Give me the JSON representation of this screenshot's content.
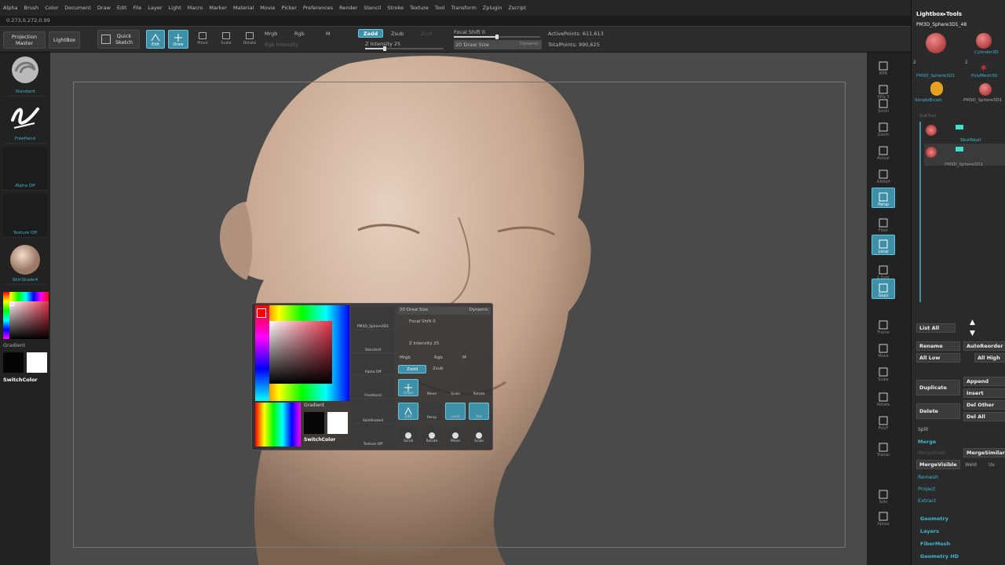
{
  "menu": [
    "Alpha",
    "Brush",
    "Color",
    "Document",
    "Draw",
    "Edit",
    "File",
    "Layer",
    "Light",
    "Macro",
    "Marker",
    "Material",
    "Movie",
    "Picker",
    "Preferences",
    "Render",
    "Stencil",
    "Stroke",
    "Texture",
    "Tool",
    "Transform",
    "Zplugin",
    "Zscript"
  ],
  "coords": "0.273,0.272,0.99",
  "topbar": {
    "projection_master": "Projection Master",
    "lightbox": "LightBox",
    "quick_sketch": "Quick Sketch",
    "edit": "Edit",
    "draw": "Draw",
    "move": "Move",
    "scale": "Scale",
    "rotate": "Rotate",
    "mrgb": "Mrgb",
    "rgb": "Rgb",
    "m": "M",
    "rgb_intensity": "Rgb Intensity",
    "zadd": "Zadd",
    "zsub": "Zsub",
    "zcut": "Zcut",
    "z_intensity_label": "Z Intensity",
    "z_intensity_value": 25,
    "focal_shift_label": "Focal Shift",
    "focal_shift_value": 0,
    "draw_size_label": "Draw Size",
    "draw_size_value": 20,
    "dynamic": "Dynamic",
    "active_points": "ActivePoints: 611,613",
    "total_points": "TotalPoints: 990,625"
  },
  "leftshelf": {
    "brush": "Standard",
    "stroke": "FreeHand",
    "alpha": "Alpha Off",
    "texture": "Texture Off",
    "material": "SkinShade4",
    "gradient": "Gradient",
    "switchcolor": "SwitchColor"
  },
  "rightshelf": [
    "BPR",
    "SPix 3",
    "Scroll",
    "Zoom",
    "Actual",
    "AAHalf",
    "Persp",
    "Floor",
    "Local",
    "L.Sym",
    "Gxyz",
    "Frame",
    "Move",
    "Scale",
    "Rotate",
    "PolyF",
    "Transp",
    "Solo",
    "Xpose"
  ],
  "tray": {
    "header": "Lightbox▸Tools",
    "current_tool": "PM3D_Sphere3D1_48",
    "tools": [
      "PM3D_Sphere3D1",
      "Cylinder3D",
      "PolyMesh3D",
      "SimpleBrush",
      "PM3D_Sphere3D1"
    ],
    "tool_nums": [
      "2",
      "2"
    ],
    "subtool_title": "SubTool",
    "subtools": [
      "SkullSkull",
      "PM3D_Sphere3D1"
    ],
    "list_all": "List All",
    "rename": "Rename",
    "autoreorder": "AutoReorder",
    "all_low": "All Low",
    "all_high": "All High",
    "duplicate": "Duplicate",
    "append": "Append",
    "insert": "Insert",
    "delete": "Delete",
    "del_other": "Del Other",
    "del_all": "Del All",
    "split": "Split",
    "merge": "Merge",
    "merge_down": "MergeDown",
    "merge_similar": "MergeSimilar",
    "merge_visible": "MergeVisible",
    "weld": "Weld",
    "uv": "Uv",
    "remesh": "Remesh",
    "project": "Project",
    "extract": "Extract",
    "geometry": "Geometry",
    "layers": "Layers",
    "fibermesh": "FiberMesh",
    "geometry_hd": "Geometry HD"
  },
  "popup": {
    "gradient": "Gradient",
    "switchcolor": "SwitchColor",
    "draw_size": "Draw Size",
    "draw_size_value": 20,
    "dynamic": "Dynamic",
    "focal_shift": "Focal Shift",
    "focal_shift_value": 0,
    "z_intensity": "Z Intensity",
    "z_intensity_value": 25,
    "zadd": "Zadd",
    "zsub": "Zsub",
    "mrgb": "Mrgb",
    "rgb": "Rgb",
    "m": "M",
    "tool": "PM3D_Sphere3D1",
    "brush": "Standard",
    "alpha": "Alpha Off",
    "stroke": "FreeHand",
    "material": "SkinShade4",
    "texture": "Texture Off",
    "draw": "Draw",
    "move": "Move",
    "scale": "Scale",
    "rotate": "Rotate",
    "edit": "Edit",
    "local": "Local",
    "xyz": "Xyz",
    "persp": "Persp",
    "scroll": "Scroll",
    "move_nav": "Move",
    "scale_nav": "Scale"
  },
  "colors": {
    "accent": "#3e8fa8",
    "label_cyan": "#3fb5d0",
    "skin": "#c9a68a",
    "primary": "#000000",
    "secondary": "#ffffff"
  }
}
